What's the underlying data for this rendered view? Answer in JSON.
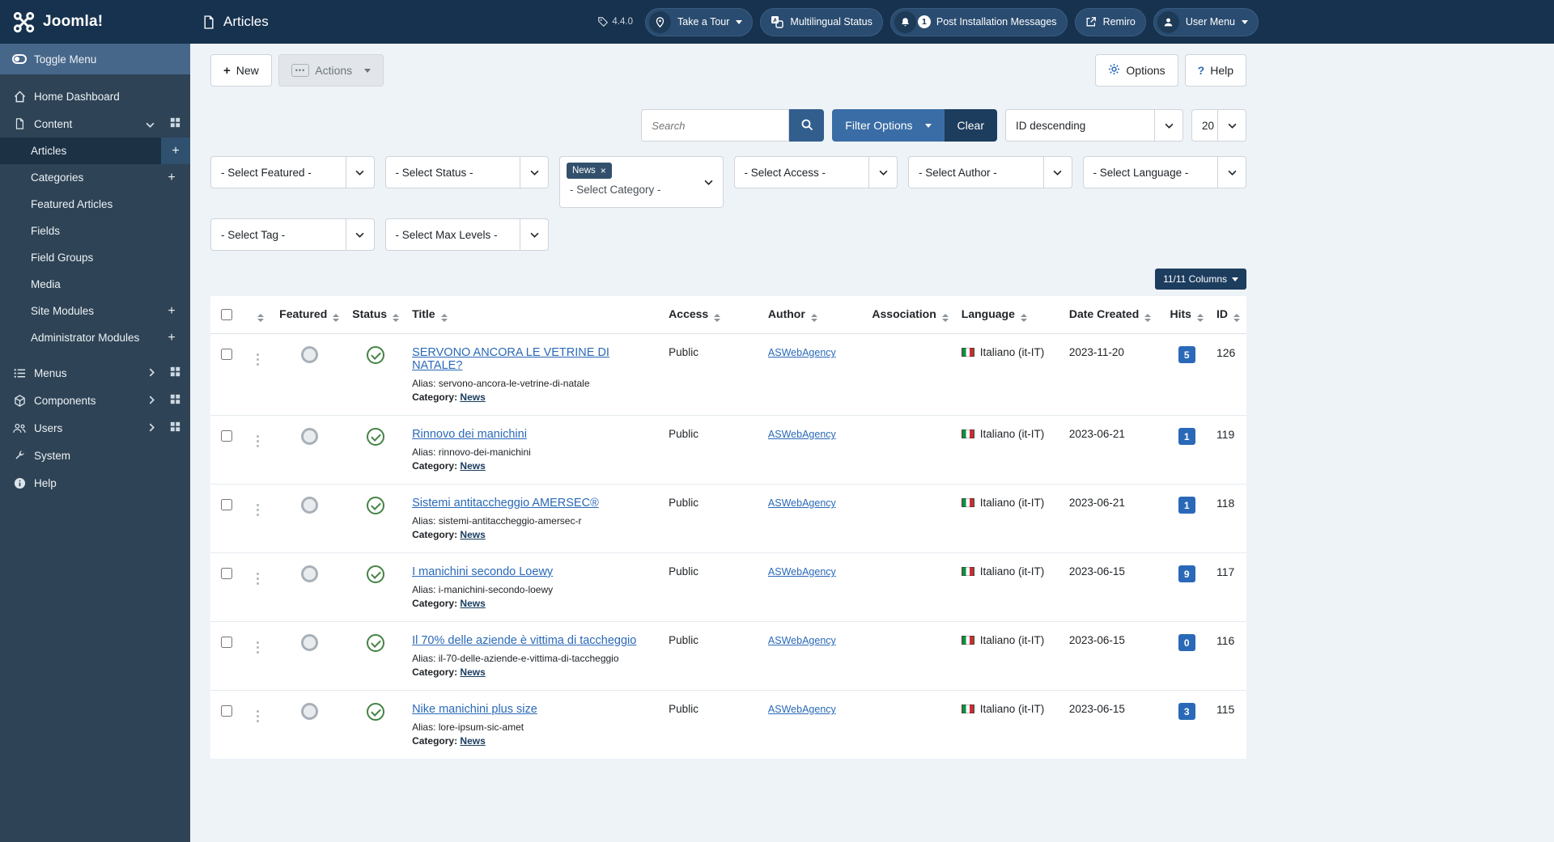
{
  "brand": {
    "name": "Joomla!"
  },
  "page": {
    "title": "Articles"
  },
  "icons": {
    "plus": "+",
    "close": "×",
    "ellipsis": "•••",
    "question": "?"
  },
  "topbar": {
    "version": "4.4.0",
    "take_a_tour": "Take a Tour",
    "multilingual_status": "Multilingual Status",
    "notification_count": "1",
    "post_installation_messages": "Post Installation Messages",
    "site_link": "Remiro",
    "user_menu": "User Menu"
  },
  "sidebar": {
    "items": [
      {
        "label": "Toggle Menu"
      },
      {
        "label": "Home Dashboard"
      },
      {
        "label": "Content"
      },
      {
        "label": "Articles"
      },
      {
        "label": "Categories"
      },
      {
        "label": "Featured Articles"
      },
      {
        "label": "Fields"
      },
      {
        "label": "Field Groups"
      },
      {
        "label": "Media"
      },
      {
        "label": "Site Modules"
      },
      {
        "label": "Administrator Modules"
      },
      {
        "label": "Menus"
      },
      {
        "label": "Components"
      },
      {
        "label": "Users"
      },
      {
        "label": "System"
      },
      {
        "label": "Help"
      }
    ]
  },
  "toolbar": {
    "new": "New",
    "actions": "Actions",
    "options": "Options",
    "help": "Help"
  },
  "filters": {
    "search_placeholder": "Search",
    "filter_options": "Filter Options",
    "clear": "Clear",
    "sort_by": "ID descending",
    "page_size": "20",
    "selects": {
      "featured": "- Select Featured -",
      "status": "- Select Status -",
      "category_chip": "News",
      "category": "- Select Category -",
      "access": "- Select Access -",
      "author": "- Select Author -",
      "language": "- Select Language -",
      "tag": "- Select Tag -",
      "max_levels": "- Select Max Levels -"
    }
  },
  "table": {
    "columns_button": "11/11 Columns",
    "headers": {
      "featured": "Featured",
      "status": "Status",
      "title": "Title",
      "access": "Access",
      "author": "Author",
      "association": "Association",
      "language": "Language",
      "date_created": "Date Created",
      "hits": "Hits",
      "id": "ID"
    },
    "labels": {
      "alias_prefix": "Alias:",
      "category_prefix": "Category:"
    }
  },
  "articles": {
    "rows": [
      {
        "title": "SERVONO ANCORA LE VETRINE DI NATALE?",
        "alias": "servono-ancora-le-vetrine-di-natale",
        "category": "News",
        "access": "Public",
        "author": "ASWebAgency",
        "language": "Italiano (it-IT)",
        "date": "2023-11-20",
        "hits": "5",
        "id": "126"
      },
      {
        "title": "Rinnovo dei manichini",
        "alias": "rinnovo-dei-manichini",
        "category": "News",
        "access": "Public",
        "author": "ASWebAgency",
        "language": "Italiano (it-IT)",
        "date": "2023-06-21",
        "hits": "1",
        "id": "119"
      },
      {
        "title": "Sistemi antitaccheggio AMERSEC®",
        "alias": "sistemi-antitaccheggio-amersec-r",
        "category": "News",
        "access": "Public",
        "author": "ASWebAgency",
        "language": "Italiano (it-IT)",
        "date": "2023-06-21",
        "hits": "1",
        "id": "118"
      },
      {
        "title": "I manichini secondo Loewy",
        "alias": "i-manichini-secondo-loewy",
        "category": "News",
        "access": "Public",
        "author": "ASWebAgency",
        "language": "Italiano (it-IT)",
        "date": "2023-06-15",
        "hits": "9",
        "id": "117"
      },
      {
        "title": "Il 70% delle aziende è vittima di taccheggio",
        "alias": "il-70-delle-aziende-e-vittima-di-taccheggio",
        "category": "News",
        "access": "Public",
        "author": "ASWebAgency",
        "language": "Italiano (it-IT)",
        "date": "2023-06-15",
        "hits": "0",
        "id": "116"
      },
      {
        "title": "Nike manichini plus size",
        "alias": "lore-ipsum-sic-amet",
        "category": "News",
        "access": "Public",
        "author": "ASWebAgency",
        "language": "Italiano (it-IT)",
        "date": "2023-06-15",
        "hits": "3",
        "id": "115"
      }
    ]
  }
}
